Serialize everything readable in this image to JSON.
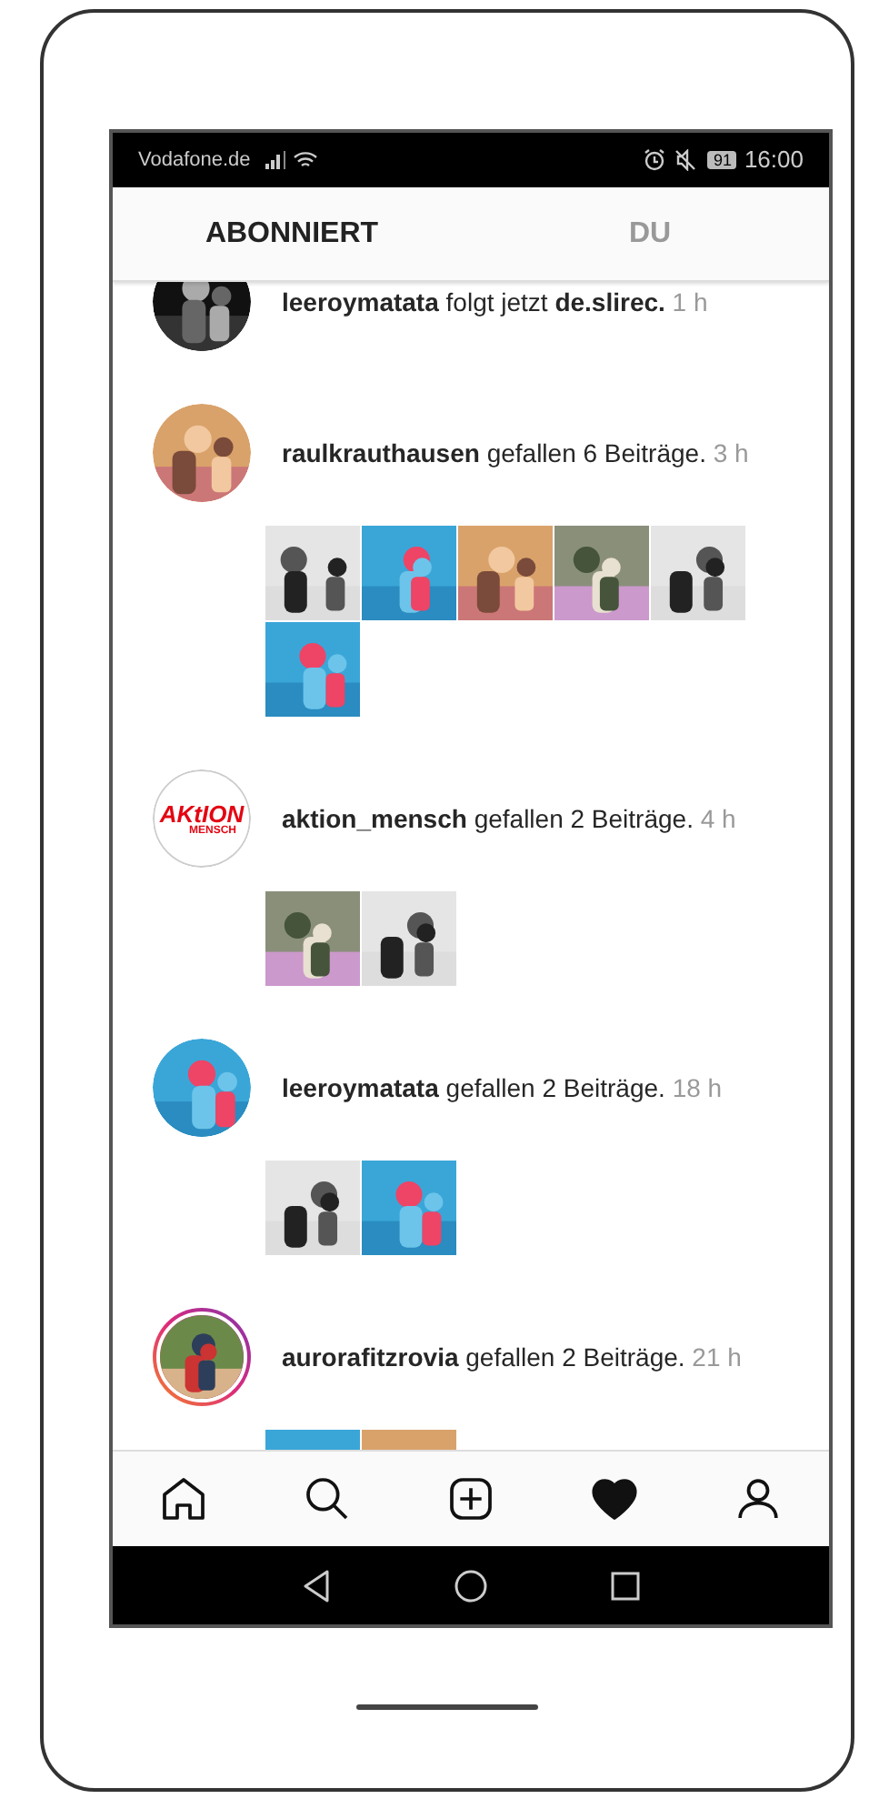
{
  "status_bar": {
    "carrier": "Vodafone.de",
    "battery": "91",
    "time": "16:00"
  },
  "tabs": [
    {
      "label": "ABONNIERT",
      "selected": true
    },
    {
      "label": "DU",
      "selected": false
    }
  ],
  "feed": [
    {
      "avatar": {
        "kind": "picture",
        "story": false
      },
      "text": "**leeroymatata** folgt jetzt **de.slirec.**",
      "time": "1 h"
    },
    {
      "avatar": {
        "kind": "picture",
        "story": false
      },
      "text": "**raulkrauthausen** gefallen 6 Beiträge.",
      "time": "3 h",
      "thumbnails": [
        {
          "kind": "picture"
        },
        {
          "kind": "picture"
        },
        {
          "kind": "picture"
        },
        {
          "kind": "picture"
        },
        {
          "kind": "picture"
        },
        {
          "kind": "picture"
        }
      ]
    },
    {
      "avatar": {
        "kind": "logo",
        "story": false,
        "logo_text": "AKtION",
        "logo_subtext": "MENSCH"
      },
      "text": "**aktion_mensch** gefallen 2 Beiträge.",
      "time": "4 h",
      "thumbnails": [
        {
          "kind": "picture"
        },
        {
          "kind": "picture"
        }
      ]
    },
    {
      "avatar": {
        "kind": "picture",
        "story": false
      },
      "text": "**leeroymatata** gefallen 2 Beiträge.",
      "time": "18 h",
      "thumbnails": [
        {
          "kind": "picture"
        },
        {
          "kind": "picture"
        }
      ]
    },
    {
      "avatar": {
        "kind": "picture",
        "story": true
      },
      "text": "**aurorafitzrovia** gefallen 2 Beiträge.",
      "time": "21 h",
      "thumbnails": [
        {
          "kind": "picture"
        },
        {
          "kind": "picture"
        }
      ]
    }
  ],
  "nav": [
    {
      "kind": "home",
      "selected": false
    },
    {
      "kind": "search",
      "selected": false
    },
    {
      "kind": "add",
      "selected": false
    },
    {
      "kind": "heart",
      "selected": true
    },
    {
      "kind": "profile",
      "selected": false
    }
  ]
}
